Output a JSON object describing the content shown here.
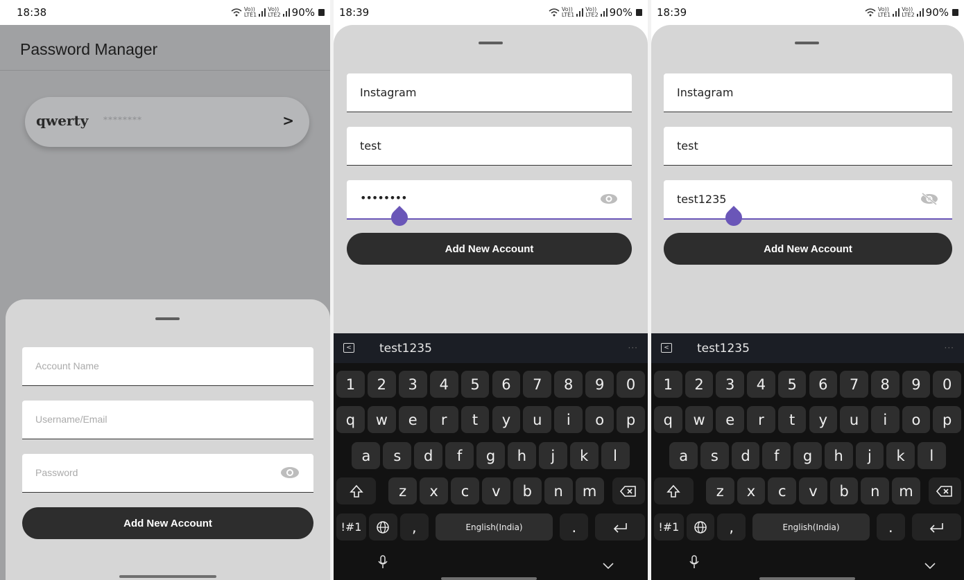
{
  "screens": [
    {
      "status": {
        "time": "18:38",
        "battery": "90%",
        "volte1": "Vo))",
        "lte1": "LTE1",
        "volte2": "Vo))",
        "lte2": "LTE2"
      },
      "app_title": "Password Manager",
      "entry": {
        "name": "qwerty",
        "masked": "********",
        "chevron": ">"
      },
      "form": {
        "account_placeholder": "Account Name",
        "username_placeholder": "Username/Email",
        "password_placeholder": "Password",
        "button_label": "Add New Account"
      }
    },
    {
      "status": {
        "time": "18:39",
        "battery": "90%",
        "volte1": "Vo))",
        "lte1": "LTE1",
        "volte2": "Vo))",
        "lte2": "LTE2"
      },
      "form": {
        "account_value": "Instagram",
        "username_value": "test",
        "password_value": "••••••••",
        "button_label": "Add New Account"
      },
      "keyboard": {
        "suggestion": "test1235",
        "language": "English(India)",
        "symbols_key": "!#1"
      }
    },
    {
      "status": {
        "time": "18:39",
        "battery": "90%",
        "volte1": "Vo))",
        "lte1": "LTE1",
        "volte2": "Vo))",
        "lte2": "LTE2"
      },
      "form": {
        "account_value": "Instagram",
        "username_value": "test",
        "password_value": "test1235",
        "button_label": "Add New Account"
      },
      "keyboard": {
        "suggestion": "test1235",
        "language": "English(India)",
        "symbols_key": "!#1"
      }
    }
  ],
  "keyboard_rows": {
    "numbers": [
      "1",
      "2",
      "3",
      "4",
      "5",
      "6",
      "7",
      "8",
      "9",
      "0"
    ],
    "row1": [
      "q",
      "w",
      "e",
      "r",
      "t",
      "y",
      "u",
      "i",
      "o",
      "p"
    ],
    "row2": [
      "a",
      "s",
      "d",
      "f",
      "g",
      "h",
      "j",
      "k",
      "l"
    ],
    "row3": [
      "z",
      "x",
      "c",
      "v",
      "b",
      "n",
      "m"
    ],
    "comma": ",",
    "period": "."
  },
  "icons": {
    "eye": "eye-icon",
    "eye_off": "eye-off-icon",
    "shift": "shift-icon",
    "backspace": "backspace-icon",
    "globe": "globe-icon",
    "enter": "enter-icon",
    "mic": "mic-icon",
    "collapse": "chevron-down-icon"
  },
  "colors": {
    "accent": "#6a56b8",
    "button": "#2d2d2d",
    "sheet": "#d6d6d6",
    "scrim": "#a0a1a3",
    "keyboard": "#121212"
  }
}
